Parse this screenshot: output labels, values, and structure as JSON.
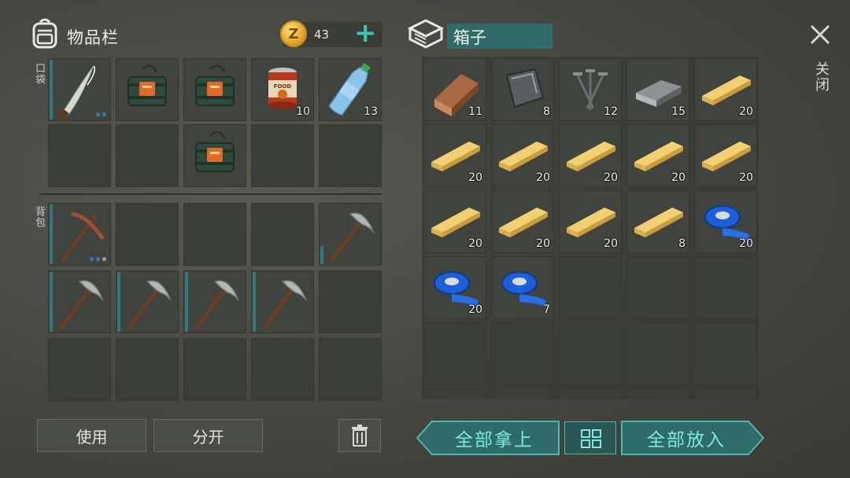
{
  "inventory": {
    "title": "物品栏",
    "coins": "43",
    "coin_symbol": "Z",
    "add_label": "+",
    "pockets_label": "口袋",
    "backpack_label": "背包",
    "pocket_slots": [
      {
        "item": "machete",
        "count": "",
        "durability": 1.0,
        "dots": 2
      },
      {
        "item": "dynamite-bundle",
        "count": ""
      },
      {
        "item": "dynamite-bundle",
        "count": ""
      },
      {
        "item": "food-can",
        "count": "10"
      },
      {
        "item": "water-bottle",
        "count": "13"
      },
      {
        "item": "",
        "count": ""
      },
      {
        "item": "",
        "count": ""
      },
      {
        "item": "dynamite-bundle",
        "count": ""
      },
      {
        "item": "",
        "count": ""
      },
      {
        "item": "",
        "count": ""
      }
    ],
    "backpack_slots": [
      {
        "item": "copper-pickaxe",
        "count": "",
        "durability": 1.0,
        "dots": 3
      },
      {
        "item": "",
        "count": ""
      },
      {
        "item": "",
        "count": ""
      },
      {
        "item": "",
        "count": ""
      },
      {
        "item": "stone-pickaxe",
        "count": "",
        "durability": 0.3
      },
      {
        "item": "stone-pickaxe",
        "count": "",
        "durability": 1.0
      },
      {
        "item": "stone-pickaxe",
        "count": "",
        "durability": 1.0
      },
      {
        "item": "stone-pickaxe",
        "count": "",
        "durability": 1.0
      },
      {
        "item": "stone-pickaxe",
        "count": "",
        "durability": 1.0
      },
      {
        "item": "",
        "count": ""
      },
      {
        "item": "",
        "count": ""
      },
      {
        "item": "",
        "count": ""
      },
      {
        "item": "",
        "count": ""
      },
      {
        "item": "",
        "count": ""
      },
      {
        "item": "",
        "count": ""
      }
    ],
    "use_label": "使用",
    "split_label": "分开"
  },
  "box": {
    "name": "箱子",
    "close_label": "关闭",
    "slots": [
      {
        "item": "log",
        "count": "11"
      },
      {
        "item": "metal-scrap",
        "count": "8"
      },
      {
        "item": "nails",
        "count": "12"
      },
      {
        "item": "iron-bar",
        "count": "15"
      },
      {
        "item": "plank",
        "count": "20"
      },
      {
        "item": "plank",
        "count": "20"
      },
      {
        "item": "plank",
        "count": "20"
      },
      {
        "item": "plank",
        "count": "20"
      },
      {
        "item": "plank",
        "count": "20"
      },
      {
        "item": "plank",
        "count": "20"
      },
      {
        "item": "plank",
        "count": "20"
      },
      {
        "item": "plank",
        "count": "20"
      },
      {
        "item": "plank",
        "count": "20"
      },
      {
        "item": "plank",
        "count": "8"
      },
      {
        "item": "blue-tape",
        "count": "20"
      },
      {
        "item": "blue-tape",
        "count": "20"
      },
      {
        "item": "blue-tape",
        "count": "7"
      },
      {
        "item": "",
        "count": ""
      },
      {
        "item": "",
        "count": ""
      },
      {
        "item": "",
        "count": ""
      },
      {
        "item": "",
        "count": ""
      },
      {
        "item": "",
        "count": ""
      },
      {
        "item": "",
        "count": ""
      },
      {
        "item": "",
        "count": ""
      },
      {
        "item": "",
        "count": ""
      },
      {
        "item": "",
        "count": ""
      },
      {
        "item": "",
        "count": ""
      },
      {
        "item": "",
        "count": ""
      },
      {
        "item": "",
        "count": ""
      },
      {
        "item": "",
        "count": ""
      }
    ],
    "take_all_label": "全部拿上",
    "put_all_label": "全部放入"
  },
  "colors": {
    "accent": "#2f6b68",
    "teal_text": "#7fe7e2",
    "durability": "#2c7a7e"
  }
}
